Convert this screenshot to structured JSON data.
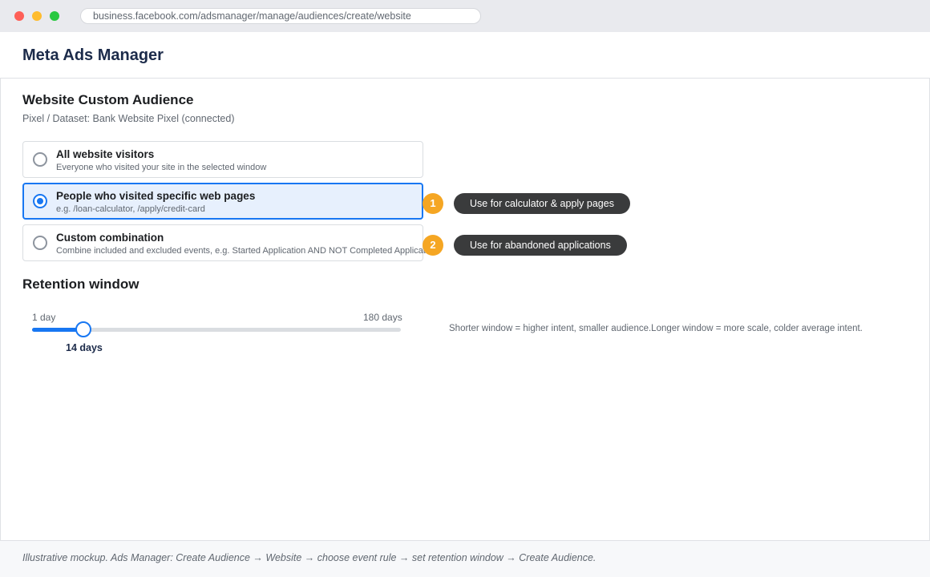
{
  "browser": {
    "url": "business.facebook.com/adsmanager/manage/audiences/create/website"
  },
  "app": {
    "title": "Meta Ads Manager"
  },
  "audience": {
    "title": "Website Custom Audience",
    "pixel_line": "Pixel / Dataset: Bank Website Pixel (connected)",
    "options": [
      {
        "title": "All website visitors",
        "description": "Everyone who visited your site in the selected window",
        "selected": false
      },
      {
        "title": "People who visited specific web pages",
        "description": "e.g. /loan-calculator, /apply/credit-card",
        "selected": true
      },
      {
        "title": "Custom combination",
        "description": "Combine included and excluded events, e.g. Started Application AND NOT Completed Application",
        "selected": false
      }
    ],
    "callouts": [
      {
        "number": "1",
        "text": "Use for calculator & apply pages"
      },
      {
        "number": "2",
        "text": "Use for abandoned applications"
      }
    ]
  },
  "retention": {
    "title": "Retention window",
    "min_label": "1 day",
    "max_label": "180 days",
    "min": 1,
    "max": 180,
    "value": 14,
    "value_label": "14 days",
    "hint": "Shorter window = higher intent, smaller audience.Longer window = more scale, colder average intent."
  },
  "footer": {
    "text": "Illustrative mockup. Ads Manager: Create Audience → Website → choose event rule → set retention window → Create Audience."
  },
  "colors": {
    "accent": "#1877f2",
    "badge": "#f5a623",
    "pill": "#3a3b3c"
  }
}
